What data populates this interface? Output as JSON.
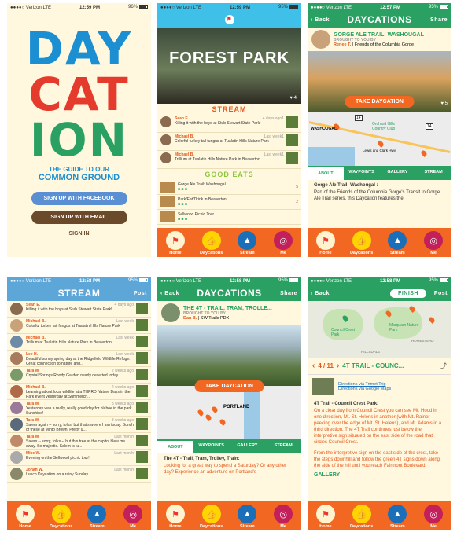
{
  "colors": {
    "accent": "#f26822",
    "green": "#2aa163",
    "stream_blue": "#5da6d8",
    "cream": "#fff8df"
  },
  "tabbar": [
    {
      "label": "Home",
      "icon": "flag-icon"
    },
    {
      "label": "Daycations",
      "icon": "thumbs-up-icon"
    },
    {
      "label": "Stream",
      "icon": "mountain-icon"
    },
    {
      "label": "Me",
      "icon": "fingerprint-icon"
    }
  ],
  "s1": {
    "status": {
      "carrier": "●●●●○ Verizon  LTE",
      "time": "12:59 PM",
      "battery": "96%"
    },
    "logo": [
      "DAY",
      "CAT",
      "ION"
    ],
    "tagline1": "THE GUIDE TO OUR",
    "tagline2": "COMMON GROUND",
    "fb": "SIGN UP WITH FACEBOOK",
    "email": "SIGN UP WITH EMAIL",
    "signin": "SIGN IN"
  },
  "s2": {
    "status": {
      "carrier": "●●●●○ Verizon  LTE",
      "time": "12:59 PM",
      "battery": "95%"
    },
    "hero": "FOREST PARK",
    "likes": "4",
    "stream_title": "STREAM",
    "stream": [
      {
        "name": "Sean E.",
        "time": "4 days ago",
        "msg": "Killing it with the boys at Stub Stewart State Park!",
        "count": "1"
      },
      {
        "name": "Michael B.",
        "time": "Last week",
        "msg": "Colorful turkey tail fungus at Tualatin Hills Nature Park",
        "count": "1"
      },
      {
        "name": "Michael B.",
        "time": "Last week",
        "msg": "Trillium at Tualatin Hills Nature Park in Beaverton",
        "count": "1"
      }
    ],
    "eats_title": "GOOD EATS",
    "eats": [
      {
        "name": "Gorge Ale Trail: Washougal",
        "count": "5"
      },
      {
        "name": "Park/Eat/Drink in Beaverton",
        "count": "2"
      },
      {
        "name": "Sellwood Picnic Tour",
        "count": ""
      }
    ]
  },
  "s3": {
    "status": {
      "carrier": "●●●●○ Verizon  LTE",
      "time": "12:57 PM",
      "battery": "95%"
    },
    "back": "Back",
    "title": "DAYCATIONS",
    "share": "Share",
    "name": "GORGE ALE TRAIL: WASHOUGAL",
    "brought": "BROUGHT TO YOU BY",
    "author": "Renee T.",
    "org": "Friends of the Columbia Gorge",
    "take": "TAKE DAYCATION",
    "likes": "5",
    "map_labels": [
      "WASHOUGAL",
      "Orchard Hills Country Club",
      "Lewis and Clark Hwy",
      "14",
      "14"
    ],
    "tabs": [
      "ABOUT",
      "WAYPOINTS",
      "GALLERY",
      "STREAM"
    ],
    "about_title": "Gorge Ale Trail: Washougal :",
    "about": "Part of the Friends of the Columbia Gorge's Transit to Gorge Ale Trail series, this Daycation features the"
  },
  "s4": {
    "status": {
      "carrier": "●●●●○ Verizon  LTE",
      "time": "12:58 PM",
      "battery": "95%"
    },
    "title": "STREAM",
    "post": "Post",
    "items": [
      {
        "name": "Sean E.",
        "time": "4 days ago",
        "msg": "Killing it with the boys at Stub Stewart State Park!"
      },
      {
        "name": "Michael B.",
        "time": "Last week",
        "msg": "Colorful turkey tail fungus at Tualatin Hills Nature Park"
      },
      {
        "name": "Michael B.",
        "time": "Last week",
        "msg": "Trillium at Tualatin Hills Nature Park in Beaverton"
      },
      {
        "name": "Lee H.",
        "time": "Last week",
        "msg": "Beautiful sunny spring day at the Ridgefield Wildlife Refuge. Great connection to nature and..."
      },
      {
        "name": "Tara W.",
        "time": "2 weeks ago",
        "msg": "Crystal Springs Rhody Garden nearly deserted today."
      },
      {
        "name": "Michael B.",
        "time": "2 weeks ago",
        "msg": "Learning about local wildlife at a THPRD Nature Days in the Park event yesterday at Summercr..."
      },
      {
        "name": "Tara W.",
        "time": "3 weeks ago",
        "msg": "Yesterday was a really, really good day for blaboe in the park. Sunshine!"
      },
      {
        "name": "Tara W.",
        "time": "3 weeks ago",
        "msg": "Salem again -- sorry, folks, but that's where I am today. Bunch of these at Minto Brown. Pretty u..."
      },
      {
        "name": "Tara W.",
        "time": "Last month",
        "msg": "Salem -- sorry, folks -- but this tree at the capitol blew me away. So majestic. Salem is ju..."
      },
      {
        "name": "Mike W.",
        "time": "Last month",
        "msg": "Evening on the Sellwood picnic tour!"
      },
      {
        "name": "Jonah W.",
        "time": "Last month",
        "msg": "Lunch Daycation on a rainy Sunday."
      }
    ]
  },
  "s5": {
    "status": {
      "carrier": "●●●●○ Verizon  LTE",
      "time": "12:58 PM",
      "battery": "95%"
    },
    "back": "Back",
    "title": "DAYCATIONS",
    "share": "Share",
    "name": "THE 4T - TRAIL, TRAM, TROLLE...",
    "brought": "BROUGHT TO YOU BY",
    "author": "Dan B.",
    "org": "SW Trails PDX",
    "take": "TAKE DAYCATION",
    "map_label": "PORTLAND",
    "tabs": [
      "ABOUT",
      "WAYPOINTS",
      "GALLERY",
      "STREAM"
    ],
    "about_title": "The 4T - Trail, Tram, Trolley, Train:",
    "about": "Looking for a great way to spend a Saturday? Or any other day? Experience an adventure on Portland's"
  },
  "s6": {
    "status": {
      "carrier": "●●●●○ Verizon  LTE",
      "time": "12:58 PM",
      "battery": "95%"
    },
    "back": "Back",
    "finish": "FINISH",
    "post": "Post",
    "map_labels": [
      "Council Crest Park",
      "Marquam Nature Park",
      "HOMESTEAD",
      "HILLSDALE"
    ],
    "counter": "4 / 11",
    "step_title": "4T TRAIL - COUNC...",
    "link1": "Directions via Trimet Trip",
    "link2": "Directions via Google Maps",
    "body_title": "4T Trail - Council Crest Park:",
    "body1": "On a clear day from Council Crest you can see Mt. Hood in one direction, Mt. St. Helens in another (with Mt. Rainer peeking over the edge of Mt. St. Helens), and Mt. Adams in a third direction. The 4T Trail continues just below the interpretive sign situated on the east side of the road that circles Council Crest.",
    "body2": "From the interpretive sign on the east side of the crest, take the steps downhill and follow the green 4T signs down along the side of the hill until you reach Fairmont Boulevard.",
    "gallery": "GALLERY"
  }
}
